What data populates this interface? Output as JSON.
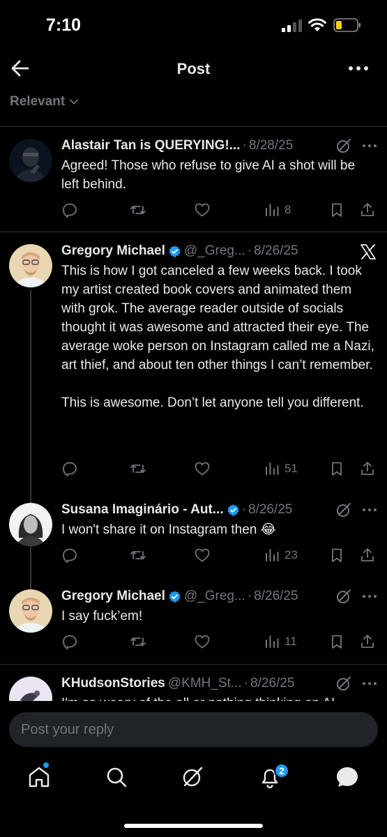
{
  "status_bar": {
    "time": "7:10"
  },
  "nav": {
    "title": "Post"
  },
  "filter": {
    "label": "Relevant"
  },
  "posts": [
    {
      "name": "Alastair Tan is QUERYING!...",
      "handle": "",
      "date": "8/28/25",
      "text": [
        "Agreed! Those who refuse to give AI a shot will be left behind."
      ],
      "views": "8"
    },
    {
      "name": "Gregory Michael",
      "handle": "@_Greg...",
      "date": "8/26/25",
      "text": [
        "This is how I got canceled a few weeks back. I took my artist created book covers and animated them with grok. The average reader outside of socials thought it was awesome and attracted their eye. The average woke person on Instagram called me a Nazi, art thief, and about ten other things I can’t remember.",
        "This is awesome. Don’t let anyone tell you different."
      ],
      "views": "51"
    },
    {
      "name": "Susana Imaginário - Aut...",
      "handle": "",
      "date": "8/26/25",
      "text": [
        "I won't share it on Instagram then 😂"
      ],
      "views": "23"
    },
    {
      "name": "Gregory Michael",
      "handle": "@_Greg...",
      "date": "8/26/25",
      "text": [
        "I say fuck’em!"
      ],
      "views": "11"
    },
    {
      "name": "KHudsonStories",
      "handle": "@KMH_St...",
      "date": "8/26/25",
      "text": [
        "I'm so weary of the all or nothing thinking on AI"
      ],
      "views": ""
    }
  ],
  "reply": {
    "placeholder": "Post your reply"
  },
  "tabbar": {
    "notifications_badge": "2"
  },
  "colors": {
    "accent": "#1d9bf0",
    "background": "#000000",
    "text": "#e7e9ea",
    "muted": "#71767b"
  }
}
